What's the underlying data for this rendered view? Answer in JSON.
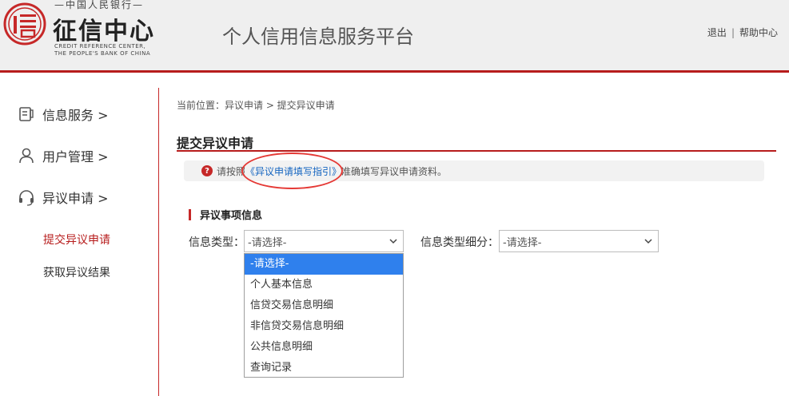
{
  "header": {
    "logo_top": "—中国人民银行—",
    "logo_main": "征信中心",
    "logo_en_line1": "CREDIT REFERENCE CENTER,",
    "logo_en_line2": "THE PEOPLE'S BANK OF CHINA",
    "platform_title": "个人信用信息服务平台",
    "logout_label": "退出",
    "separator": "|",
    "help_label": "帮助中心"
  },
  "sidebar": {
    "items": [
      {
        "label": "信息服务 >",
        "icon": "document-icon"
      },
      {
        "label": "用户管理 >",
        "icon": "user-icon"
      },
      {
        "label": "异议申请 >",
        "icon": "headset-icon"
      }
    ],
    "sub_items": [
      {
        "label": "提交异议申请",
        "active": true
      },
      {
        "label": "获取异议结果",
        "active": false
      }
    ]
  },
  "main": {
    "breadcrumb": "当前位置：异议申请 > 提交异议申请",
    "page_title": "提交异议申请",
    "notice_prefix": "请按照",
    "notice_link": "《异议申请填写指引》",
    "notice_suffix": "准确填写异议申请资料。",
    "section_title": "异议事项信息",
    "field1_label": "信息类型：",
    "field1_value": "-请选择-",
    "field2_label": "信息类型细分：",
    "field2_value": "-请选择-",
    "dropdown_options": [
      "-请选择-",
      "个人基本信息",
      "信贷交易信息明细",
      "非信贷交易信息明细",
      "公共信息明细",
      "查询记录"
    ]
  },
  "colors": {
    "brand_red": "#b71c1c",
    "link_blue": "#1565c0",
    "selected_blue": "#2f80ed"
  }
}
